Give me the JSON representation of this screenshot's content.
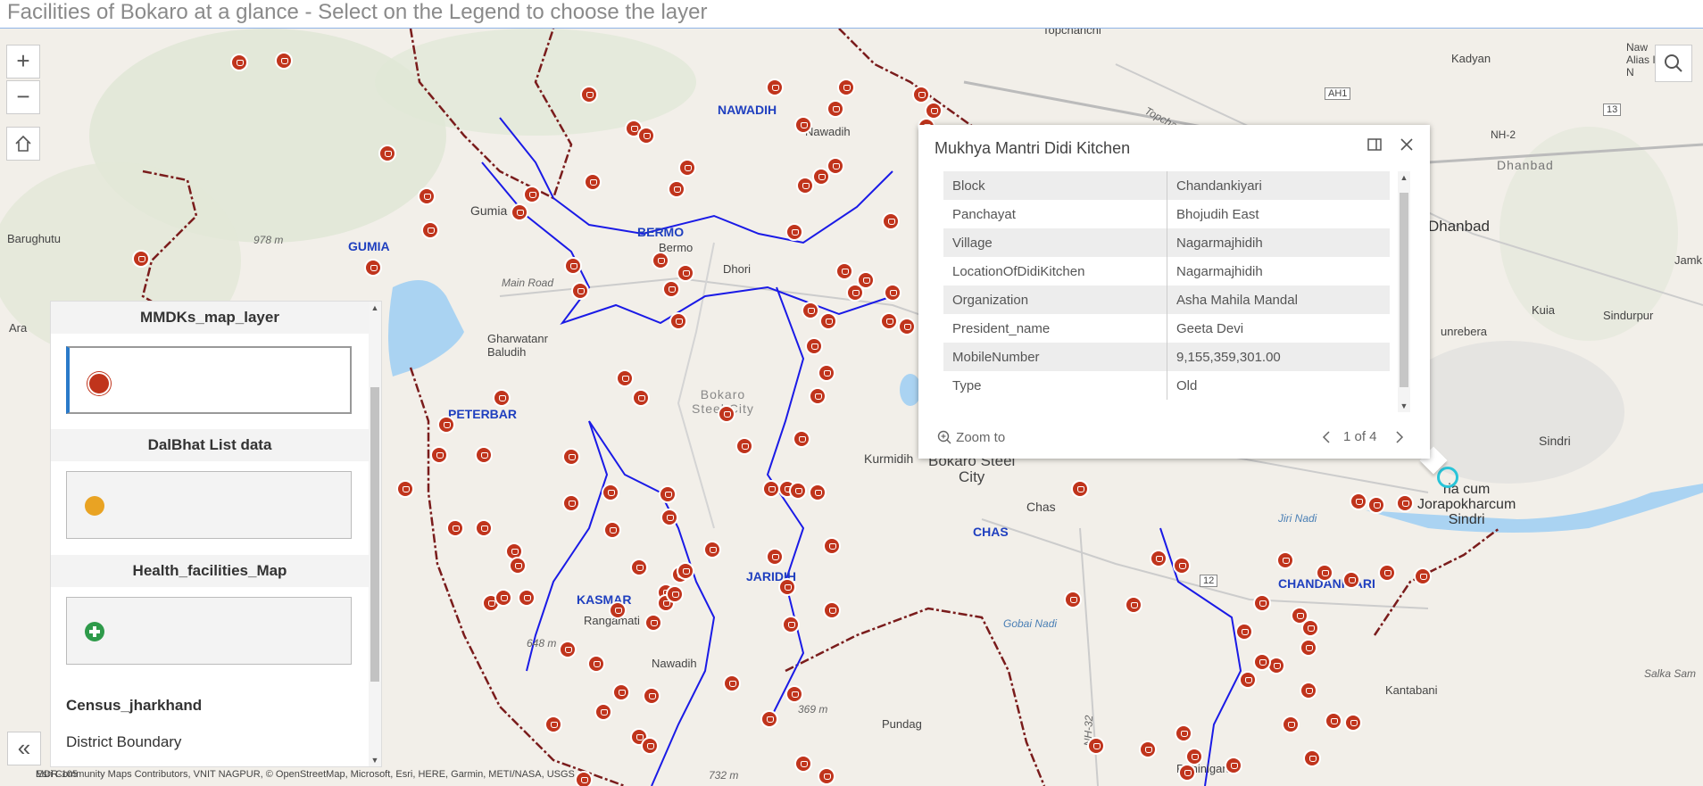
{
  "title": "Facilities of Bokaro at a glance - Select on the Legend to choose the layer",
  "colors": {
    "marker": "#c0341c",
    "boundary_district": "#7a1c1c",
    "boundary_block": "#1a1ae6",
    "water": "#aad3f2",
    "dalbhat": "#e9a323",
    "health": "#2e9a4a"
  },
  "map": {
    "place_labels": [
      {
        "id": "topchanchi",
        "text": "Topchanchi"
      },
      {
        "id": "kadyan",
        "text": "Kadyan"
      },
      {
        "id": "naw-alias",
        "text": "Naw\nAlias I\nN"
      },
      {
        "id": "nawadih-n",
        "text": "NAWADIH"
      },
      {
        "id": "nawadih-small",
        "text": "Nawadih"
      },
      {
        "id": "dhanbad-label",
        "text": "Dhanbad"
      },
      {
        "id": "dhanbad-city",
        "text": "Dhanbad"
      },
      {
        "id": "gumia",
        "text": "Gumia"
      },
      {
        "id": "barughutu",
        "text": "Barughutu"
      },
      {
        "id": "gumia-block",
        "text": "GUMIA"
      },
      {
        "id": "bermo",
        "text": "BERMO"
      },
      {
        "id": "bermo-small",
        "text": "Bermo"
      },
      {
        "id": "dhori",
        "text": "Dhori"
      },
      {
        "id": "ara",
        "text": "Ara"
      },
      {
        "id": "ghaetwatanr",
        "text": "Gharwatanr\nBaludih"
      },
      {
        "id": "peterbar",
        "text": "PETERBAR"
      },
      {
        "id": "bokaro-steel",
        "text": "Bokaro\nSteel City"
      },
      {
        "id": "kurmidih",
        "text": "Kurmidih"
      },
      {
        "id": "bokaro-city",
        "text": "Bokaro Steel\nCity"
      },
      {
        "id": "chas-town",
        "text": "Chas"
      },
      {
        "id": "chas",
        "text": "CHAS"
      },
      {
        "id": "jamk",
        "text": "Jamk"
      },
      {
        "id": "sindurpur",
        "text": "Sindurpur"
      },
      {
        "id": "kuia",
        "text": "Kuia"
      },
      {
        "id": "unrebera",
        "text": "unrebera"
      },
      {
        "id": "sindri",
        "text": "Sindri"
      },
      {
        "id": "jorapokhar",
        "text": "ria cum\nJorapokharcum\nSindri"
      },
      {
        "id": "jaridih",
        "text": "JARIDIH"
      },
      {
        "id": "kasmar",
        "text": "KASMAR"
      },
      {
        "id": "rangamati",
        "text": "Rangamati"
      },
      {
        "id": "nawadih-s",
        "text": "Nawadih"
      },
      {
        "id": "chandankiari",
        "text": "CHANDANKIARI"
      },
      {
        "id": "pundag",
        "text": "Pundag"
      },
      {
        "id": "rahinigara",
        "text": "Rahinigara"
      },
      {
        "id": "kantabani",
        "text": "Kantabani"
      },
      {
        "id": "salka",
        "text": "Salka Sam"
      },
      {
        "id": "main-road",
        "text": "Main Road"
      },
      {
        "id": "gobai-nadi",
        "text": "Gobai Nadi"
      },
      {
        "id": "jiri-nadi",
        "text": "Jiri Nadi"
      },
      {
        "id": "h978",
        "text": "978 m"
      },
      {
        "id": "h648",
        "text": "648 m"
      },
      {
        "id": "h369",
        "text": "369 m"
      },
      {
        "id": "h732",
        "text": "732 m"
      },
      {
        "id": "topchanchi-rd",
        "text": "Topchanchi Road"
      },
      {
        "id": "nh2",
        "text": "NH-2"
      },
      {
        "id": "ah1",
        "text": "AH1"
      },
      {
        "id": "r13",
        "text": "13"
      },
      {
        "id": "r12",
        "text": "12"
      },
      {
        "id": "nh32",
        "text": "NH-32"
      },
      {
        "id": "mdr",
        "text": "MDR-105"
      }
    ],
    "attribution": "Esri Community Maps Contributors, VNIT NAGPUR, © OpenStreetMap, Microsoft, Esri, HERE, Garmin, METI/NASA, USGS"
  },
  "legend": {
    "layers": [
      {
        "title": "MMDKs_map_layer",
        "icon": "kitchen-marker-icon"
      },
      {
        "title": "DalBhat List data",
        "icon": "dalbhat-marker-icon"
      },
      {
        "title": "Health_facilities_Map",
        "icon": "health-cross-icon"
      }
    ],
    "census": {
      "title": "Census_jharkhand",
      "item": "District Boundary"
    }
  },
  "popup": {
    "title": "Mukhya Mantri Didi Kitchen",
    "rows": [
      {
        "field": "Block",
        "value": "Chandankiyari"
      },
      {
        "field": "Panchayat",
        "value": "Bhojudih East"
      },
      {
        "field": "Village",
        "value": "Nagarmajhidih"
      },
      {
        "field": "LocationOfDidiKitchen",
        "value": "Nagarmajhidih"
      },
      {
        "field": "Organization",
        "value": "Asha Mahila Mandal"
      },
      {
        "field": "President_name",
        "value": "Geeta Devi"
      },
      {
        "field": "MobileNumber",
        "value": "9,155,359,301.00"
      },
      {
        "field": "Type",
        "value": "Old"
      }
    ],
    "zoom_to": "Zoom to",
    "pager": "1 of 4"
  }
}
